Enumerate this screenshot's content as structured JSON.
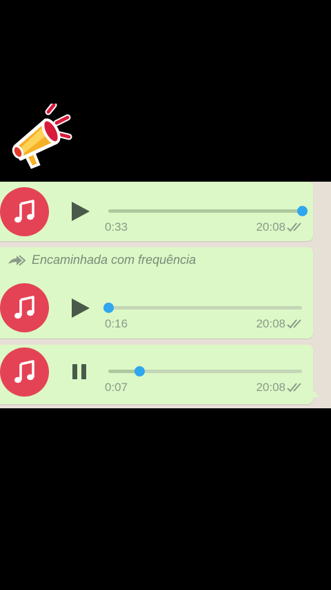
{
  "messages": [
    {
      "forwarded_label": "",
      "duration": "0:33",
      "time": "20:08",
      "progress": 1.0,
      "state": "play",
      "ticks": "read"
    },
    {
      "forwarded_label": "Encaminhada com frequência",
      "duration": "0:16",
      "time": "20:08",
      "progress": 0.0,
      "state": "play",
      "ticks": "read"
    },
    {
      "forwarded_label": "",
      "duration": "0:07",
      "time": "20:08",
      "progress": 0.16,
      "state": "pause",
      "ticks": "read"
    }
  ],
  "icons": {
    "sticker": "megaphone-icon",
    "avatar": "music-note-icon",
    "play": "play-icon",
    "pause": "pause-icon",
    "forward": "double-forward-arrow-icon",
    "ticks": "double-check-icon"
  },
  "colors": {
    "bubble": "#dcf8c6",
    "avatar": "#e44356",
    "knob": "#2fa6ee",
    "chat_background": "#e7e0d6"
  }
}
